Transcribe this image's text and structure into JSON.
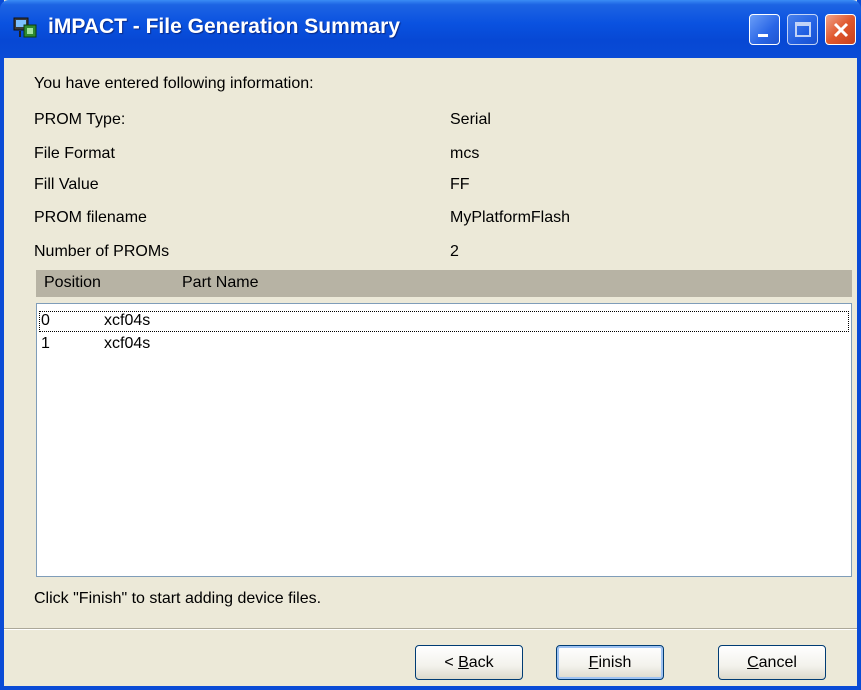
{
  "window": {
    "title": "iMPACT - File Generation Summary",
    "controls": {
      "minimize_icon": "minimize-icon",
      "maximize_icon": "maximize-icon",
      "close_icon": "close-icon"
    },
    "accent": "#0a4bd6"
  },
  "summary": {
    "intro": "You have entered following information:",
    "fields": [
      {
        "label": "PROM Type:",
        "value": "Serial"
      },
      {
        "label": "File Format",
        "value": "mcs"
      },
      {
        "label": "Fill Value",
        "value": "FF"
      },
      {
        "label": "PROM filename",
        "value": "MyPlatformFlash"
      },
      {
        "label": "Number of PROMs",
        "value": "2"
      }
    ]
  },
  "table": {
    "columns": [
      "Position",
      "Part Name"
    ],
    "rows": [
      {
        "position": "0",
        "part": "xcf04s"
      },
      {
        "position": "1",
        "part": "xcf04s"
      }
    ]
  },
  "footer": {
    "note": "Click \"Finish\" to start adding device files."
  },
  "buttons": {
    "back": {
      "mnemonic": "B",
      "rest": "ack",
      "prefix": "< "
    },
    "finish": {
      "mnemonic": "F",
      "rest": "inish"
    },
    "cancel": {
      "mnemonic": "C",
      "rest": "ancel"
    }
  }
}
